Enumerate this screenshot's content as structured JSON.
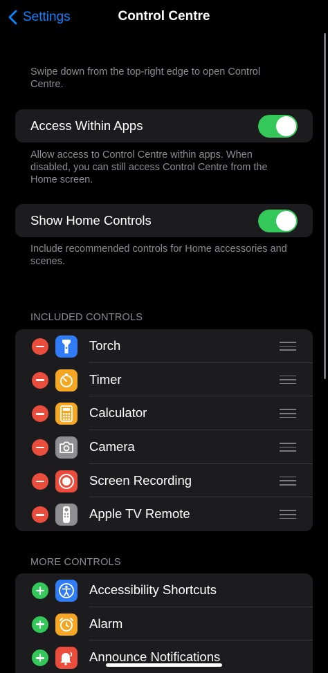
{
  "nav": {
    "back_label": "Settings",
    "title": "Control Centre"
  },
  "intro_note": "Swipe down from the top-right edge to open Control Centre.",
  "access_within_apps": {
    "label": "Access Within Apps",
    "enabled": true,
    "note": "Allow access to Control Centre within apps. When disabled, you can still access Control Centre from the Home screen."
  },
  "show_home_controls": {
    "label": "Show Home Controls",
    "enabled": true,
    "note": "Include recommended controls for Home accessories and scenes."
  },
  "included": {
    "header": "INCLUDED CONTROLS",
    "items": [
      {
        "label": "Torch",
        "icon": "torch-icon",
        "color": "#2f7cf6"
      },
      {
        "label": "Timer",
        "icon": "timer-icon",
        "color": "#f5a623"
      },
      {
        "label": "Calculator",
        "icon": "calculator-icon",
        "color": "#f5a623"
      },
      {
        "label": "Camera",
        "icon": "camera-icon",
        "color": "#8e8e93"
      },
      {
        "label": "Screen Recording",
        "icon": "screen-recording-icon",
        "color": "#eb4d3d"
      },
      {
        "label": "Apple TV Remote",
        "icon": "apple-tv-remote-icon",
        "color": "#8e8e93"
      }
    ]
  },
  "more": {
    "header": "MORE CONTROLS",
    "items": [
      {
        "label": "Accessibility Shortcuts",
        "icon": "accessibility-icon",
        "color": "#2f7cf6"
      },
      {
        "label": "Alarm",
        "icon": "alarm-icon",
        "color": "#f5a623"
      },
      {
        "label": "Announce Notifications",
        "icon": "announce-notifications-icon",
        "color": "#eb4d3d"
      }
    ]
  },
  "colors": {
    "accent": "#0a84ff",
    "switch_on": "#34c759",
    "remove": "#eb4d3d",
    "add": "#34c759"
  }
}
